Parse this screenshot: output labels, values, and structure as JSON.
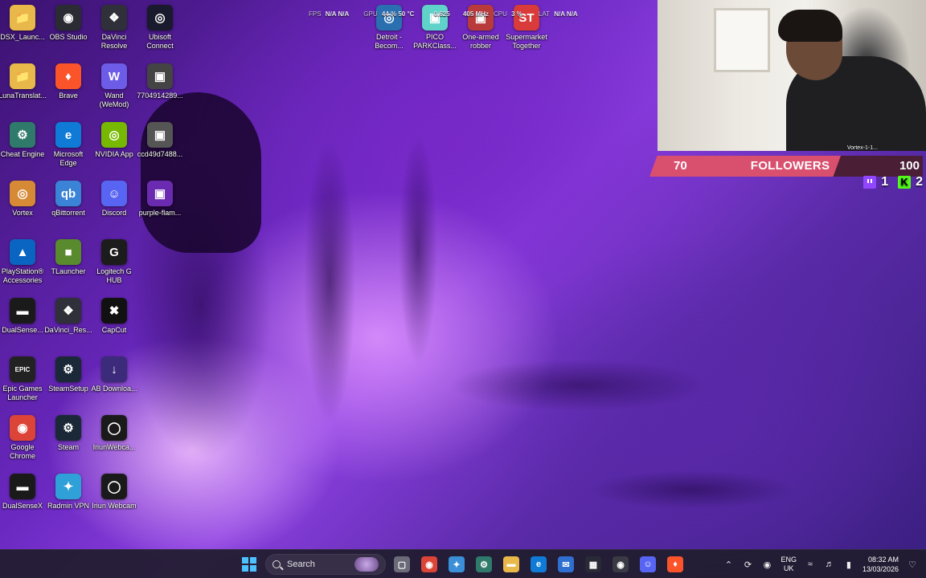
{
  "desktop": {
    "icons": [
      {
        "label": "DSX_Launc...",
        "glyph": "📁",
        "color": "#e8b84a"
      },
      {
        "label": "OBS Studio",
        "glyph": "◉",
        "color": "#2b2b33"
      },
      {
        "label": "DaVinci Resolve",
        "glyph": "❖",
        "color": "#30303a"
      },
      {
        "label": "Ubisoft Connect",
        "glyph": "◎",
        "color": "#1a1a2e"
      },
      {
        "label": "LunaTranslat...",
        "glyph": "📁",
        "color": "#e8b84a"
      },
      {
        "label": "Brave",
        "glyph": "♦",
        "color": "#fb542b"
      },
      {
        "label": "Wand (WeMod)",
        "glyph": "W",
        "color": "#6c5ce7"
      },
      {
        "label": "7704914289...",
        "glyph": "▣",
        "color": "#444"
      },
      {
        "label": "Cheat Engine",
        "glyph": "⚙",
        "color": "#2f7a6a"
      },
      {
        "label": "Microsoft Edge",
        "glyph": "e",
        "color": "#0f7bd6"
      },
      {
        "label": "NVIDIA App",
        "glyph": "◎",
        "color": "#76b900"
      },
      {
        "label": "ccd49d7488...",
        "glyph": "▣",
        "color": "#555"
      },
      {
        "label": "Vortex",
        "glyph": "◎",
        "color": "#d78a36"
      },
      {
        "label": "qBittorrent",
        "glyph": "qb",
        "color": "#3a83d6"
      },
      {
        "label": "Discord",
        "glyph": "☺",
        "color": "#5865f2"
      },
      {
        "label": "purple-flam...",
        "glyph": "▣",
        "color": "#6a2bb0"
      },
      {
        "label": "PlayStation® Accessories",
        "glyph": "▲",
        "color": "#0a65c2"
      },
      {
        "label": "TLauncher",
        "glyph": "■",
        "color": "#5a8a2e"
      },
      {
        "label": "Logitech G HUB",
        "glyph": "G",
        "color": "#1c1c1c"
      },
      {
        "label": "DualSense...",
        "glyph": "▬",
        "color": "#1a1a1a"
      },
      {
        "label": "DaVinci_Res...",
        "glyph": "❖",
        "color": "#30303a"
      },
      {
        "label": "CapCut",
        "glyph": "✖",
        "color": "#111"
      },
      {
        "label": "Epic Games Launcher",
        "glyph": "EPIC",
        "color": "#222"
      },
      {
        "label": "SteamSetup",
        "glyph": "⚙",
        "color": "#1b2838"
      },
      {
        "label": "AB Downloa...",
        "glyph": "↓",
        "color": "#3c2a7a"
      },
      {
        "label": "Google Chrome",
        "glyph": "◉",
        "color": "#db4437"
      },
      {
        "label": "Steam",
        "glyph": "⚙",
        "color": "#1b2838"
      },
      {
        "label": "IriunWebca...",
        "glyph": "◯",
        "color": "#1a1a1a"
      },
      {
        "label": "DualSenseX",
        "glyph": "▬",
        "color": "#1a1a1a"
      },
      {
        "label": "Radmin VPN",
        "glyph": "✦",
        "color": "#2fa0d8"
      },
      {
        "label": "Iriun Webcam",
        "glyph": "◯",
        "color": "#1a1a1a"
      }
    ],
    "top_icons": [
      {
        "label": "Detroit - Becom...",
        "glyph": "◎",
        "color": "#2a6fb0"
      },
      {
        "label": "PICO PARKClass...",
        "glyph": "▣",
        "color": "#5fd3c9"
      },
      {
        "label": "One-armed robber",
        "glyph": "▣",
        "color": "#b83a3a"
      },
      {
        "label": "Supermarket Together",
        "glyph": "ST",
        "color": "#d93a3a"
      }
    ]
  },
  "stats": {
    "fps_label": "FPS",
    "fps_value": "N/A",
    "fps_value2": "N/A",
    "gpu_label": "GPU",
    "gpu_value": "44 %",
    "gpu_temp": "50 °C",
    "mem_value": "0.625",
    "clock_value": "405 MHz",
    "cpu_label": "CPU",
    "cpu_value": "3 %",
    "lat_label": "LAT",
    "lat_value": "N/A",
    "lat_value2": "N/A"
  },
  "webcam": {
    "name": "Vortex-1-1..."
  },
  "followers": {
    "current": "70",
    "title": "FOLLOWERS",
    "goal": "100",
    "progress": 0.7,
    "bar_color": "#d9506f"
  },
  "platforms": {
    "twitch_count": "1",
    "kick_count": "2"
  },
  "taskbar": {
    "search_placeholder": "Search",
    "apps": [
      {
        "name": "task-view",
        "glyph": "▢",
        "color": "#6a6a78"
      },
      {
        "name": "chrome",
        "glyph": "◉",
        "color": "#db4437"
      },
      {
        "name": "copilot",
        "glyph": "✦",
        "color": "#3a8fd8"
      },
      {
        "name": "cheat-engine",
        "glyph": "⚙",
        "color": "#2f7a6a"
      },
      {
        "name": "file-explorer",
        "glyph": "▬",
        "color": "#e8b84a"
      },
      {
        "name": "edge",
        "glyph": "e",
        "color": "#0f7bd6"
      },
      {
        "name": "outlook",
        "glyph": "✉",
        "color": "#2f6fd0"
      },
      {
        "name": "store",
        "glyph": "▦",
        "color": "#2a2a36"
      },
      {
        "name": "obs",
        "glyph": "◉",
        "color": "#3a3a44"
      },
      {
        "name": "discord",
        "glyph": "☺",
        "color": "#5865f2"
      },
      {
        "name": "brave",
        "glyph": "♦",
        "color": "#fb542b"
      }
    ],
    "lang_top": "ENG",
    "lang_bottom": "UK",
    "time": "08:32 AM",
    "date": "13/03/2026"
  },
  "colors": {
    "windows_blue": "#4cc2ff",
    "accent_purple": "#7a35d6"
  }
}
